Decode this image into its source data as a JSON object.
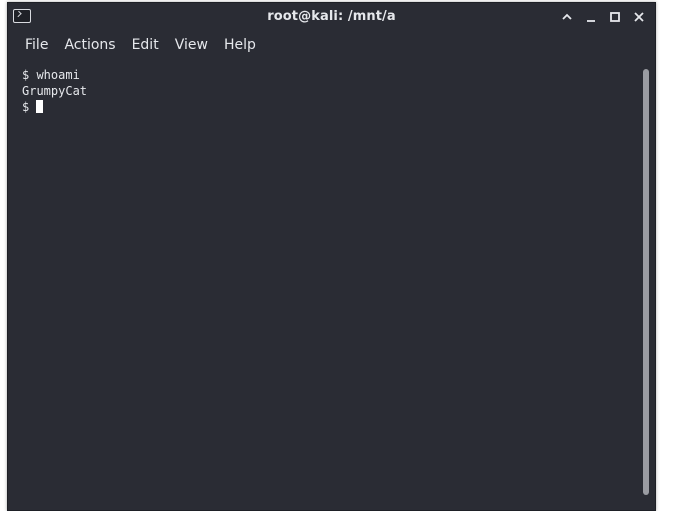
{
  "window": {
    "title": "root@kali: /mnt/a"
  },
  "menubar": {
    "items": [
      "File",
      "Actions",
      "Edit",
      "View",
      "Help"
    ]
  },
  "terminal": {
    "lines": [
      "$ whoami",
      "GrumpyCat",
      "$ "
    ]
  },
  "icons": {
    "app": "terminal-icon",
    "maximize": "chevron-up-icon",
    "minimize": "minimize-icon",
    "restore": "maximize-icon",
    "close": "close-icon"
  },
  "colors": {
    "background": "#2a2c34",
    "text": "#e6e8ec",
    "scrollbar": "#9a9ca2"
  }
}
